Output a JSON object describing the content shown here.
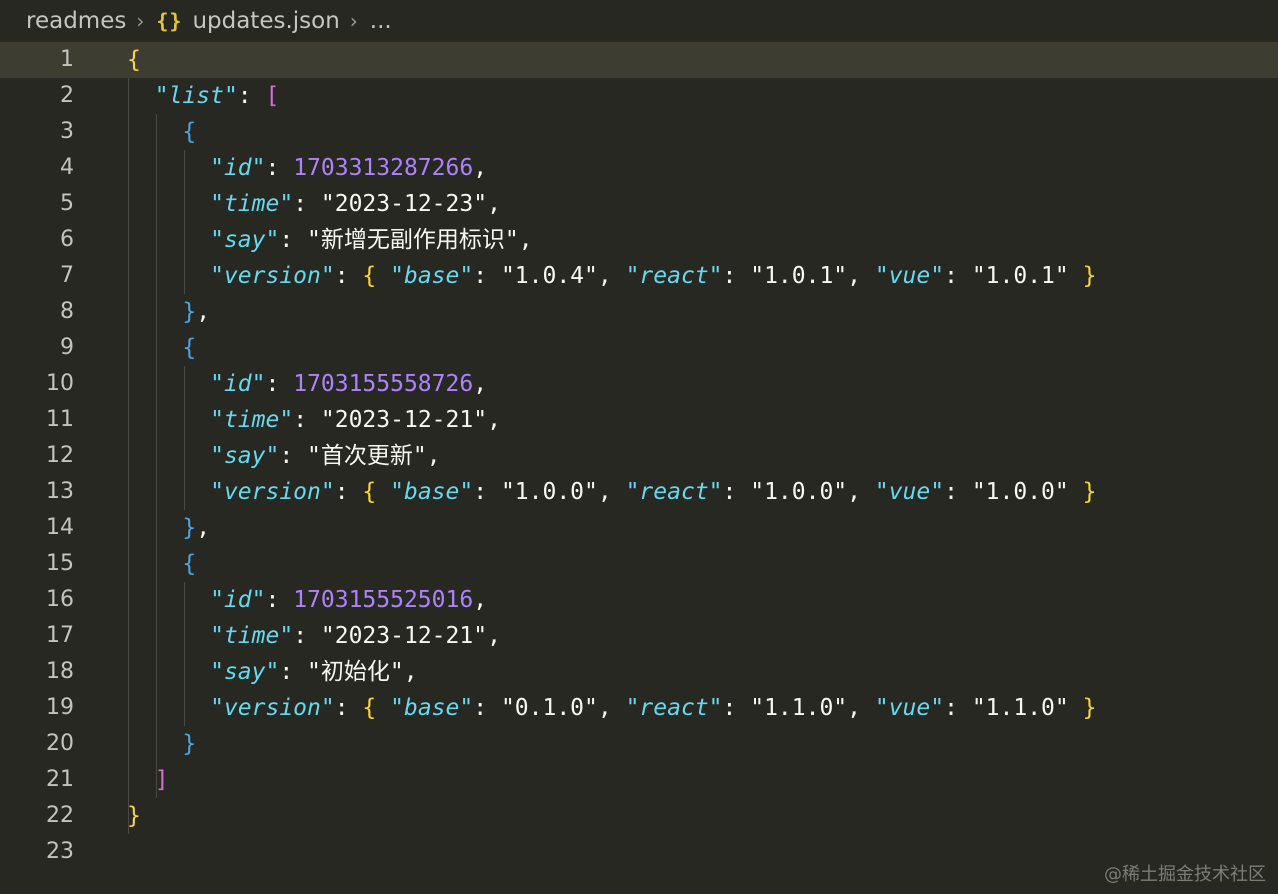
{
  "breadcrumb": {
    "folder": "readmes",
    "file_icon": "{}",
    "file": "updates.json",
    "more": "..."
  },
  "lines": [
    {
      "n": "1",
      "tokens": [
        {
          "t": "{",
          "c": "b1"
        }
      ]
    },
    {
      "n": "2",
      "tokens": [
        {
          "t": "  ",
          "c": ""
        },
        {
          "t": "\"list\"",
          "c": "k"
        },
        {
          "t": ": ",
          "c": ""
        },
        {
          "t": "[",
          "c": "b2"
        }
      ]
    },
    {
      "n": "3",
      "tokens": [
        {
          "t": "    ",
          "c": ""
        },
        {
          "t": "{",
          "c": "b3"
        }
      ]
    },
    {
      "n": "4",
      "tokens": [
        {
          "t": "      ",
          "c": ""
        },
        {
          "t": "\"id\"",
          "c": "k"
        },
        {
          "t": ": ",
          "c": ""
        },
        {
          "t": "1703313287266",
          "c": "n"
        },
        {
          "t": ",",
          "c": ""
        }
      ]
    },
    {
      "n": "5",
      "tokens": [
        {
          "t": "      ",
          "c": ""
        },
        {
          "t": "\"time\"",
          "c": "k"
        },
        {
          "t": ": ",
          "c": ""
        },
        {
          "t": "\"2023-12-23\"",
          "c": "str"
        },
        {
          "t": ",",
          "c": ""
        }
      ]
    },
    {
      "n": "6",
      "tokens": [
        {
          "t": "      ",
          "c": ""
        },
        {
          "t": "\"say\"",
          "c": "k"
        },
        {
          "t": ": ",
          "c": ""
        },
        {
          "t": "\"新增无副作用标识\"",
          "c": "str"
        },
        {
          "t": ",",
          "c": ""
        }
      ]
    },
    {
      "n": "7",
      "tokens": [
        {
          "t": "      ",
          "c": ""
        },
        {
          "t": "\"version\"",
          "c": "k"
        },
        {
          "t": ": ",
          "c": ""
        },
        {
          "t": "{",
          "c": "b1"
        },
        {
          "t": " ",
          "c": ""
        },
        {
          "t": "\"base\"",
          "c": "k"
        },
        {
          "t": ": ",
          "c": ""
        },
        {
          "t": "\"1.0.4\"",
          "c": "str"
        },
        {
          "t": ", ",
          "c": ""
        },
        {
          "t": "\"react\"",
          "c": "k"
        },
        {
          "t": ": ",
          "c": ""
        },
        {
          "t": "\"1.0.1\"",
          "c": "str"
        },
        {
          "t": ", ",
          "c": ""
        },
        {
          "t": "\"vue\"",
          "c": "k"
        },
        {
          "t": ": ",
          "c": ""
        },
        {
          "t": "\"1.0.1\"",
          "c": "str"
        },
        {
          "t": " ",
          "c": ""
        },
        {
          "t": "}",
          "c": "b1"
        }
      ]
    },
    {
      "n": "8",
      "tokens": [
        {
          "t": "    ",
          "c": ""
        },
        {
          "t": "}",
          "c": "b3"
        },
        {
          "t": ",",
          "c": ""
        }
      ]
    },
    {
      "n": "9",
      "tokens": [
        {
          "t": "    ",
          "c": ""
        },
        {
          "t": "{",
          "c": "b3"
        }
      ]
    },
    {
      "n": "10",
      "tokens": [
        {
          "t": "      ",
          "c": ""
        },
        {
          "t": "\"id\"",
          "c": "k"
        },
        {
          "t": ": ",
          "c": ""
        },
        {
          "t": "1703155558726",
          "c": "n"
        },
        {
          "t": ",",
          "c": ""
        }
      ]
    },
    {
      "n": "11",
      "tokens": [
        {
          "t": "      ",
          "c": ""
        },
        {
          "t": "\"time\"",
          "c": "k"
        },
        {
          "t": ": ",
          "c": ""
        },
        {
          "t": "\"2023-12-21\"",
          "c": "str"
        },
        {
          "t": ",",
          "c": ""
        }
      ]
    },
    {
      "n": "12",
      "tokens": [
        {
          "t": "      ",
          "c": ""
        },
        {
          "t": "\"say\"",
          "c": "k"
        },
        {
          "t": ": ",
          "c": ""
        },
        {
          "t": "\"首次更新\"",
          "c": "str"
        },
        {
          "t": ",",
          "c": ""
        }
      ]
    },
    {
      "n": "13",
      "tokens": [
        {
          "t": "      ",
          "c": ""
        },
        {
          "t": "\"version\"",
          "c": "k"
        },
        {
          "t": ": ",
          "c": ""
        },
        {
          "t": "{",
          "c": "b1"
        },
        {
          "t": " ",
          "c": ""
        },
        {
          "t": "\"base\"",
          "c": "k"
        },
        {
          "t": ": ",
          "c": ""
        },
        {
          "t": "\"1.0.0\"",
          "c": "str"
        },
        {
          "t": ", ",
          "c": ""
        },
        {
          "t": "\"react\"",
          "c": "k"
        },
        {
          "t": ": ",
          "c": ""
        },
        {
          "t": "\"1.0.0\"",
          "c": "str"
        },
        {
          "t": ", ",
          "c": ""
        },
        {
          "t": "\"vue\"",
          "c": "k"
        },
        {
          "t": ": ",
          "c": ""
        },
        {
          "t": "\"1.0.0\"",
          "c": "str"
        },
        {
          "t": " ",
          "c": ""
        },
        {
          "t": "}",
          "c": "b1"
        }
      ]
    },
    {
      "n": "14",
      "tokens": [
        {
          "t": "    ",
          "c": ""
        },
        {
          "t": "}",
          "c": "b3"
        },
        {
          "t": ",",
          "c": ""
        }
      ]
    },
    {
      "n": "15",
      "tokens": [
        {
          "t": "    ",
          "c": ""
        },
        {
          "t": "{",
          "c": "b3"
        }
      ]
    },
    {
      "n": "16",
      "tokens": [
        {
          "t": "      ",
          "c": ""
        },
        {
          "t": "\"id\"",
          "c": "k"
        },
        {
          "t": ": ",
          "c": ""
        },
        {
          "t": "1703155525016",
          "c": "n"
        },
        {
          "t": ",",
          "c": ""
        }
      ]
    },
    {
      "n": "17",
      "tokens": [
        {
          "t": "      ",
          "c": ""
        },
        {
          "t": "\"time\"",
          "c": "k"
        },
        {
          "t": ": ",
          "c": ""
        },
        {
          "t": "\"2023-12-21\"",
          "c": "str"
        },
        {
          "t": ",",
          "c": ""
        }
      ]
    },
    {
      "n": "18",
      "tokens": [
        {
          "t": "      ",
          "c": ""
        },
        {
          "t": "\"say\"",
          "c": "k"
        },
        {
          "t": ": ",
          "c": ""
        },
        {
          "t": "\"初始化\"",
          "c": "str"
        },
        {
          "t": ",",
          "c": ""
        }
      ]
    },
    {
      "n": "19",
      "tokens": [
        {
          "t": "      ",
          "c": ""
        },
        {
          "t": "\"version\"",
          "c": "k"
        },
        {
          "t": ": ",
          "c": ""
        },
        {
          "t": "{",
          "c": "b1"
        },
        {
          "t": " ",
          "c": ""
        },
        {
          "t": "\"base\"",
          "c": "k"
        },
        {
          "t": ": ",
          "c": ""
        },
        {
          "t": "\"0.1.0\"",
          "c": "str"
        },
        {
          "t": ", ",
          "c": ""
        },
        {
          "t": "\"react\"",
          "c": "k"
        },
        {
          "t": ": ",
          "c": ""
        },
        {
          "t": "\"1.1.0\"",
          "c": "str"
        },
        {
          "t": ", ",
          "c": ""
        },
        {
          "t": "\"vue\"",
          "c": "k"
        },
        {
          "t": ": ",
          "c": ""
        },
        {
          "t": "\"1.1.0\"",
          "c": "str"
        },
        {
          "t": " ",
          "c": ""
        },
        {
          "t": "}",
          "c": "b1"
        }
      ]
    },
    {
      "n": "20",
      "tokens": [
        {
          "t": "    ",
          "c": ""
        },
        {
          "t": "}",
          "c": "b3"
        }
      ]
    },
    {
      "n": "21",
      "tokens": [
        {
          "t": "  ",
          "c": ""
        },
        {
          "t": "]",
          "c": "b2"
        }
      ]
    },
    {
      "n": "22",
      "tokens": [
        {
          "t": "}",
          "c": "b1"
        }
      ]
    },
    {
      "n": "23",
      "tokens": []
    }
  ],
  "watermark": "@稀土掘金技术社区",
  "colors": {
    "background": "#272822",
    "current_line": "#3e3d32",
    "key": "#66d9ef",
    "number": "#ae81ff",
    "bracket_level1": "#f7d63a",
    "bracket_level2": "#d46fd2",
    "bracket_level3": "#4aa4e8"
  }
}
